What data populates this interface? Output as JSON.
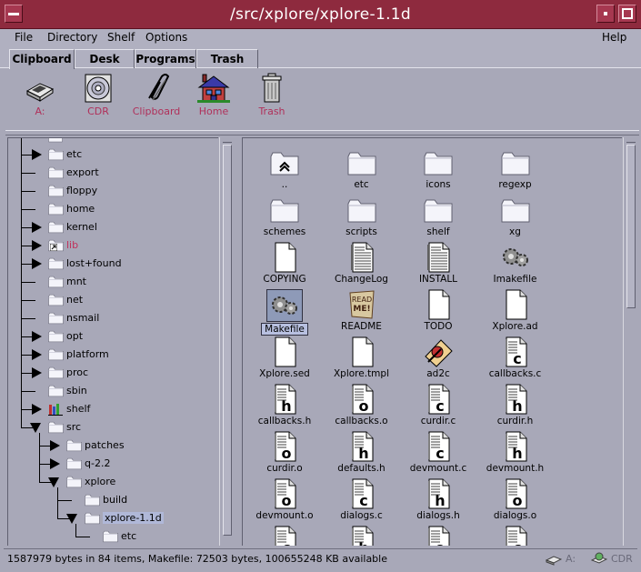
{
  "window": {
    "title": "/src/xplore/xplore-1.1d"
  },
  "menu": {
    "file": "File",
    "directory": "Directory",
    "shelf": "Shelf",
    "options": "Options",
    "help": "Help"
  },
  "tabs": [
    "Clipboard",
    "Desk",
    "Programs",
    "Trash"
  ],
  "shelf": [
    {
      "label": "A:",
      "icon": "floppy-drive-icon"
    },
    {
      "label": "CDR",
      "icon": "cdrom-icon"
    },
    {
      "label": "Clipboard",
      "icon": "paperclip-icon"
    },
    {
      "label": "Home",
      "icon": "house-icon"
    },
    {
      "label": "Trash",
      "icon": "trash-can-icon"
    }
  ],
  "tree": [
    {
      "label": "etc",
      "depth": 0,
      "state": "collapsed"
    },
    {
      "label": "export",
      "depth": 0,
      "state": "leaf"
    },
    {
      "label": "floppy",
      "depth": 0,
      "state": "leaf"
    },
    {
      "label": "home",
      "depth": 0,
      "state": "leaf"
    },
    {
      "label": "kernel",
      "depth": 0,
      "state": "collapsed"
    },
    {
      "label": "lib",
      "depth": 0,
      "state": "collapsed",
      "link": true
    },
    {
      "label": "lost+found",
      "depth": 0,
      "state": "collapsed"
    },
    {
      "label": "mnt",
      "depth": 0,
      "state": "leaf"
    },
    {
      "label": "net",
      "depth": 0,
      "state": "leaf"
    },
    {
      "label": "nsmail",
      "depth": 0,
      "state": "leaf"
    },
    {
      "label": "opt",
      "depth": 0,
      "state": "collapsed"
    },
    {
      "label": "platform",
      "depth": 0,
      "state": "collapsed"
    },
    {
      "label": "proc",
      "depth": 0,
      "state": "collapsed"
    },
    {
      "label": "sbin",
      "depth": 0,
      "state": "leaf"
    },
    {
      "label": "shelf",
      "depth": 0,
      "state": "collapsed",
      "special": true
    },
    {
      "label": "src",
      "depth": 0,
      "state": "expanded"
    },
    {
      "label": "patches",
      "depth": 1,
      "state": "collapsed"
    },
    {
      "label": "q-2.2",
      "depth": 1,
      "state": "collapsed"
    },
    {
      "label": "xplore",
      "depth": 1,
      "state": "expanded"
    },
    {
      "label": "build",
      "depth": 2,
      "state": "leaf"
    },
    {
      "label": "xplore-1.1d",
      "depth": 2,
      "state": "expanded",
      "selected": true
    },
    {
      "label": "etc",
      "depth": 3,
      "state": "leaf"
    }
  ],
  "files": [
    {
      "name": "..",
      "type": "parent"
    },
    {
      "name": "etc",
      "type": "folder"
    },
    {
      "name": "icons",
      "type": "folder"
    },
    {
      "name": "regexp",
      "type": "folder"
    },
    {
      "name": "schemes",
      "type": "folder"
    },
    {
      "name": "scripts",
      "type": "folder"
    },
    {
      "name": "shelf",
      "type": "folder"
    },
    {
      "name": "xg",
      "type": "folder"
    },
    {
      "name": "COPYING",
      "type": "doc"
    },
    {
      "name": "ChangeLog",
      "type": "text"
    },
    {
      "name": "INSTALL",
      "type": "text"
    },
    {
      "name": "Imakefile",
      "type": "gear"
    },
    {
      "name": "Makefile",
      "type": "gear",
      "selected": true
    },
    {
      "name": "README",
      "type": "readme"
    },
    {
      "name": "TODO",
      "type": "doc"
    },
    {
      "name": "Xplore.ad",
      "type": "doc"
    },
    {
      "name": "Xplore.sed",
      "type": "doc"
    },
    {
      "name": "Xplore.tmpl",
      "type": "doc"
    },
    {
      "name": "ad2c",
      "type": "exec"
    },
    {
      "name": "callbacks.c",
      "type": "c"
    },
    {
      "name": "callbacks.h",
      "type": "h"
    },
    {
      "name": "callbacks.o",
      "type": "o"
    },
    {
      "name": "curdir.c",
      "type": "c"
    },
    {
      "name": "curdir.h",
      "type": "h"
    },
    {
      "name": "curdir.o",
      "type": "o"
    },
    {
      "name": "defaults.h",
      "type": "h"
    },
    {
      "name": "devmount.c",
      "type": "c"
    },
    {
      "name": "devmount.h",
      "type": "h"
    },
    {
      "name": "devmount.o",
      "type": "o"
    },
    {
      "name": "dialogs.c",
      "type": "c"
    },
    {
      "name": "dialogs.h",
      "type": "h"
    },
    {
      "name": "dialogs.o",
      "type": "o"
    },
    {
      "name": "",
      "type": "c"
    },
    {
      "name": "",
      "type": "h"
    },
    {
      "name": "",
      "type": "o"
    },
    {
      "name": "",
      "type": "c"
    }
  ],
  "status": {
    "text": "1587979 bytes in 84 items, Makefile: 72503 bytes, 100655248 KB available",
    "device1": "A:",
    "device2": "CDR"
  }
}
